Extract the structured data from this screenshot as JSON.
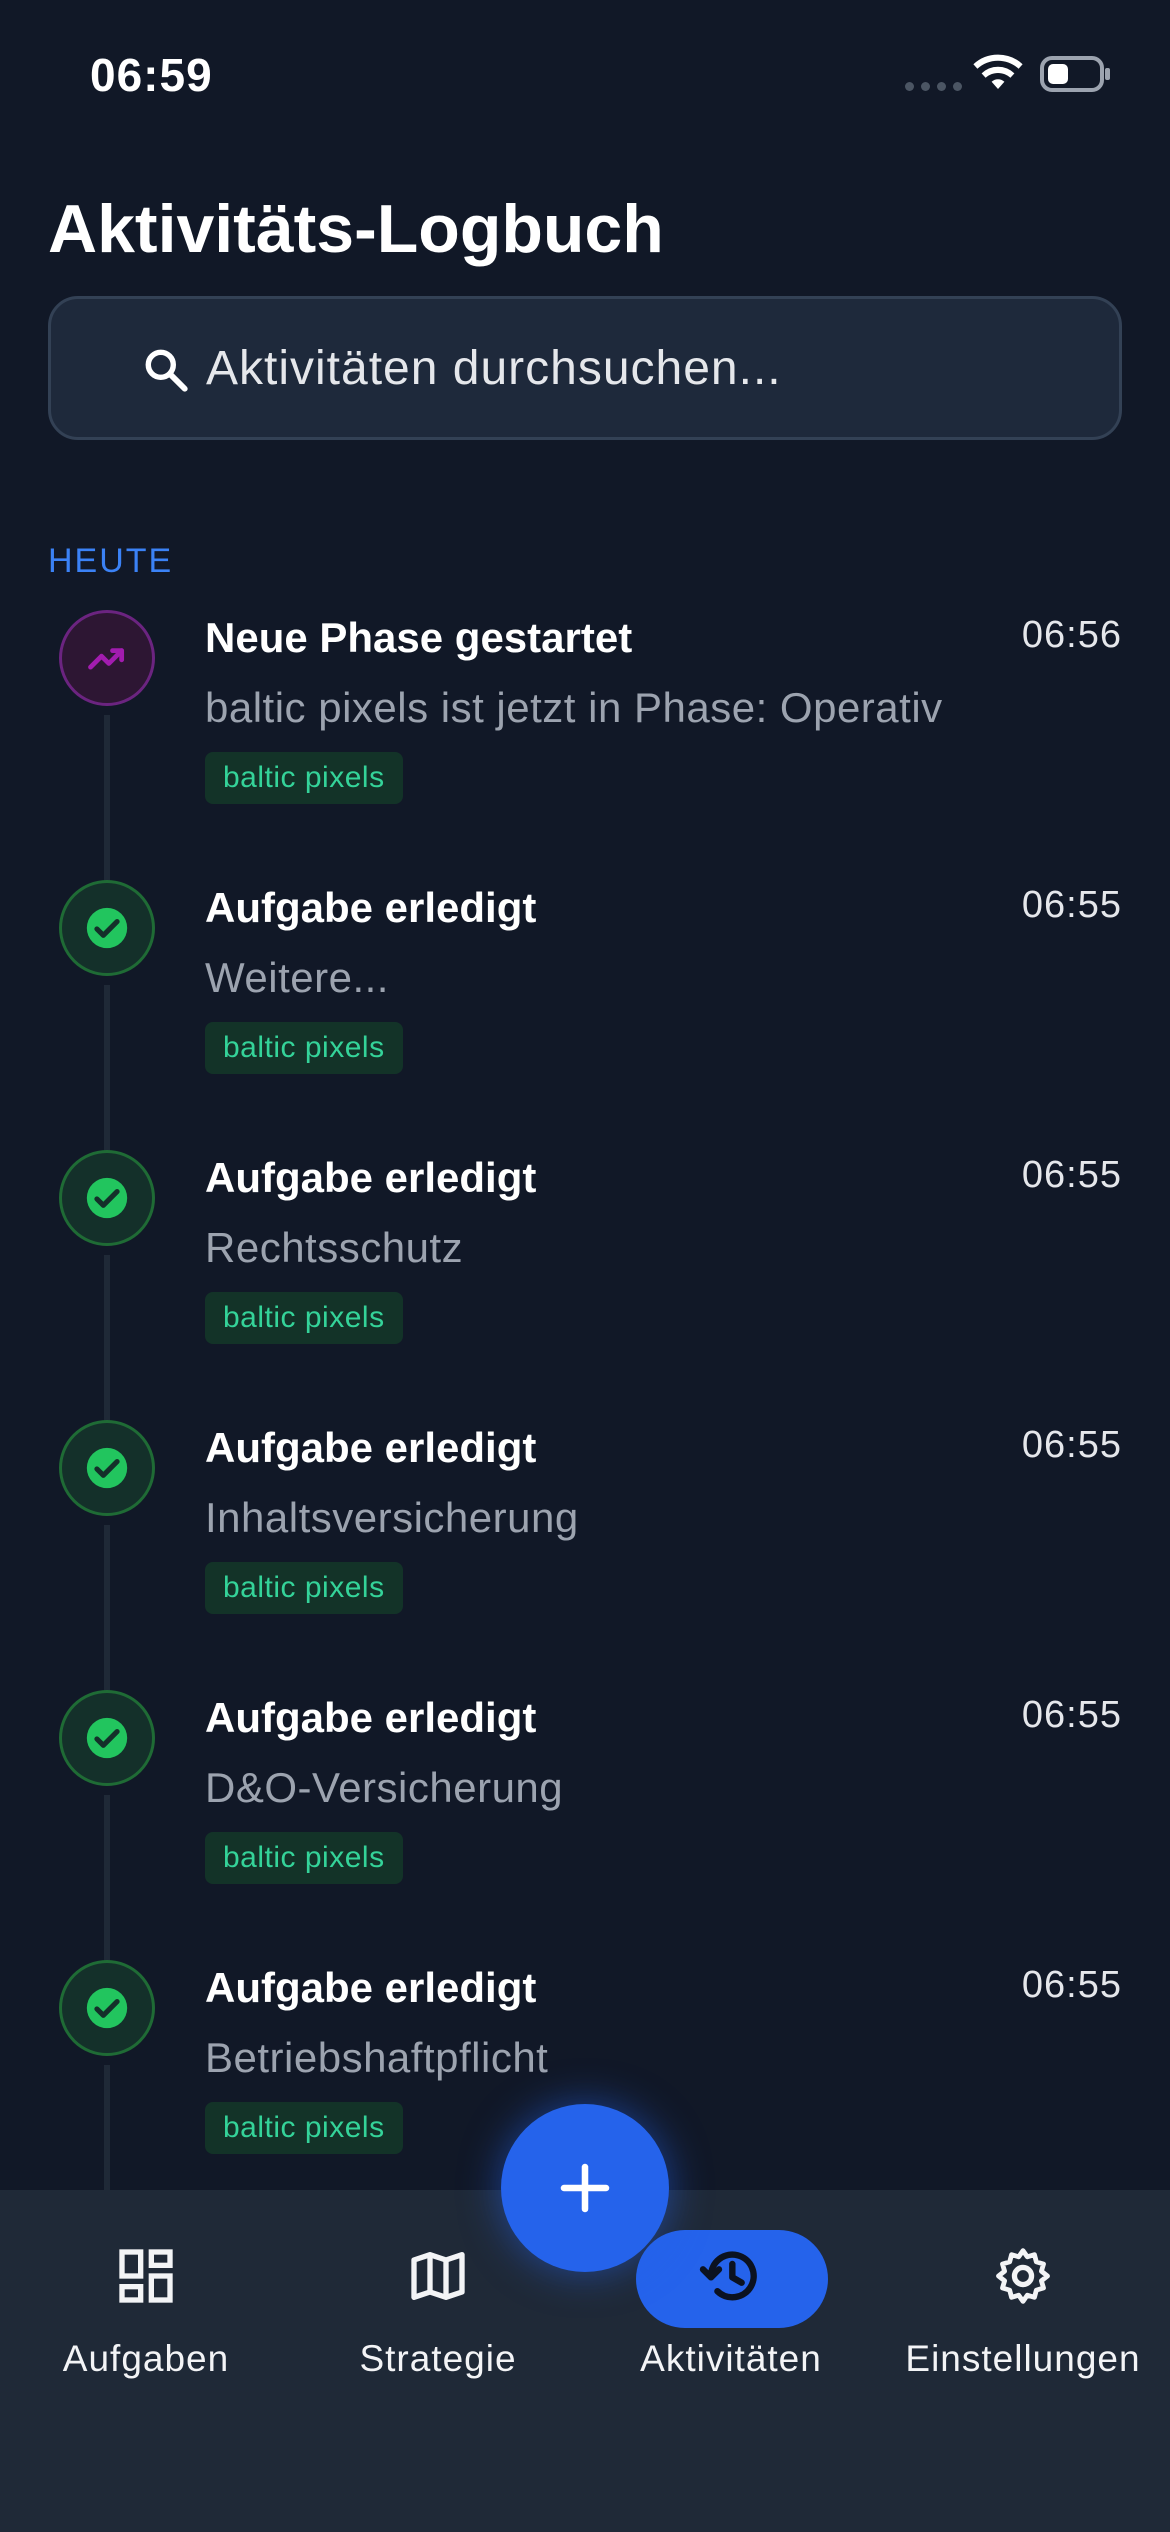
{
  "status_bar": {
    "time": "06:59"
  },
  "header": {
    "title": "Aktivitäts-Logbuch",
    "search_placeholder": "Aktivitäten durchsuchen..."
  },
  "section": {
    "heading": "HEUTE"
  },
  "entries": [
    {
      "type": "phase",
      "icon": "trending-up-icon",
      "title": "Neue Phase gestartet",
      "time": "06:56",
      "description": "baltic pixels ist jetzt in Phase: Operativ",
      "tag": "baltic pixels"
    },
    {
      "type": "done",
      "icon": "check-circle-icon",
      "title": "Aufgabe erledigt",
      "time": "06:55",
      "description": "Weitere...",
      "tag": "baltic pixels"
    },
    {
      "type": "done",
      "icon": "check-circle-icon",
      "title": "Aufgabe erledigt",
      "time": "06:55",
      "description": "Rechtsschutz",
      "tag": "baltic pixels"
    },
    {
      "type": "done",
      "icon": "check-circle-icon",
      "title": "Aufgabe erledigt",
      "time": "06:55",
      "description": "Inhaltsversicherung",
      "tag": "baltic pixels"
    },
    {
      "type": "done",
      "icon": "check-circle-icon",
      "title": "Aufgabe erledigt",
      "time": "06:55",
      "description": "D&O-Versicherung",
      "tag": "baltic pixels"
    },
    {
      "type": "done",
      "icon": "check-circle-icon",
      "title": "Aufgabe erledigt",
      "time": "06:55",
      "description": "Betriebshaftpflicht",
      "tag": "baltic pixels"
    }
  ],
  "nav": {
    "items": [
      {
        "label": "Aufgaben",
        "icon": "dashboard-icon"
      },
      {
        "label": "Strategie",
        "icon": "map-icon"
      },
      {
        "label": "Aktivitäten",
        "icon": "history-icon",
        "active": true
      },
      {
        "label": "Einstellungen",
        "icon": "gear-icon"
      }
    ]
  },
  "colors": {
    "background": "#111827",
    "accent": "#2563eb",
    "section_heading": "#3b82f6",
    "tag_text": "#34d399",
    "done_icon": "#22c55e",
    "phase_icon": "#a21caf"
  }
}
